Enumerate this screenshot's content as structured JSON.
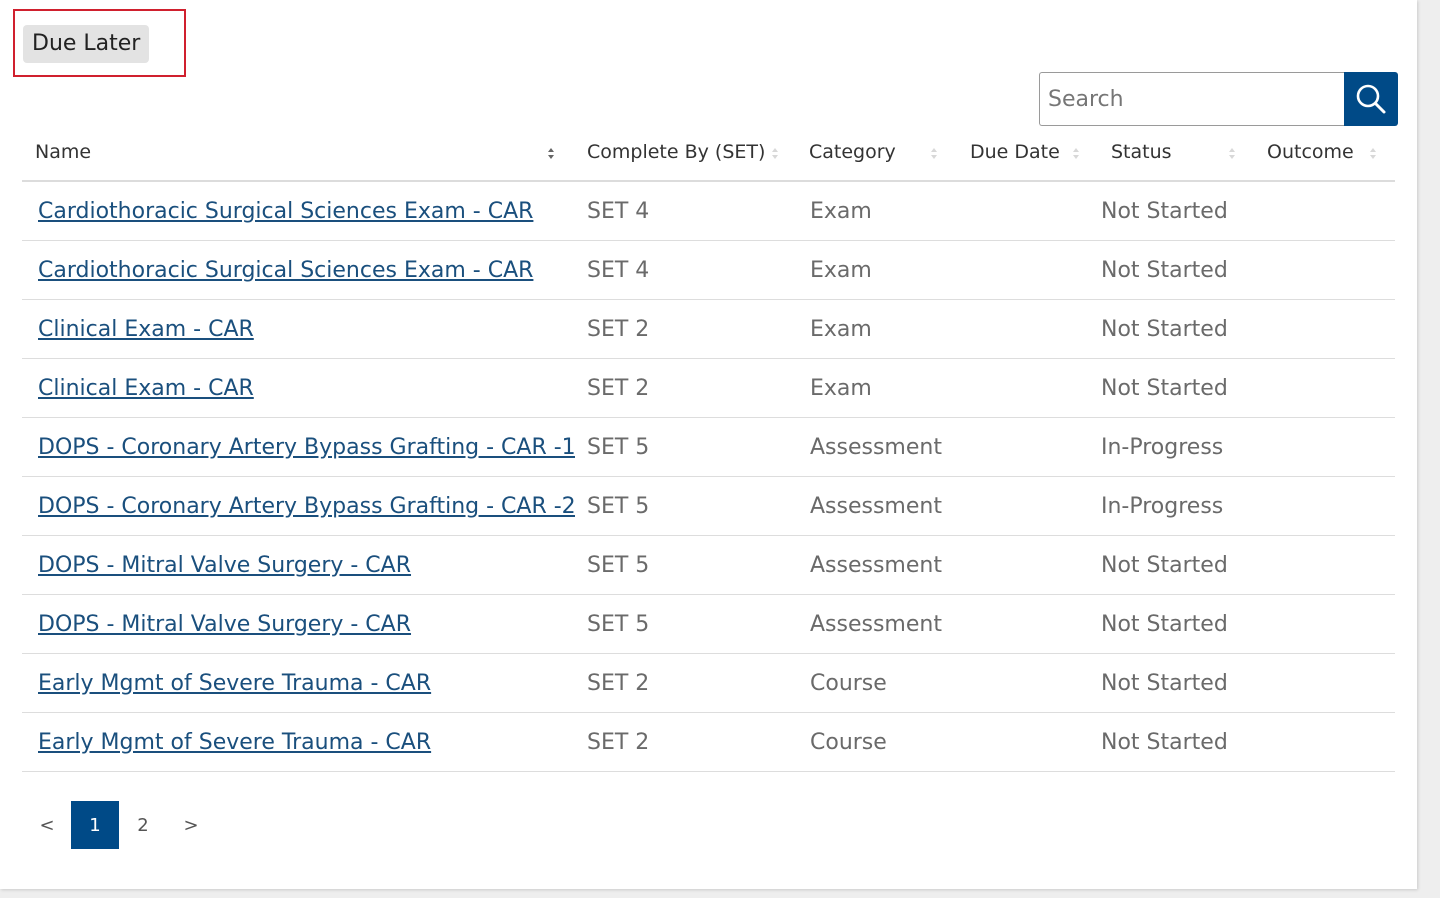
{
  "tab": {
    "label": "Due Later"
  },
  "search": {
    "placeholder": "Search"
  },
  "table": {
    "columns": [
      "Name",
      "Complete By (SET)",
      "Category",
      "Due Date",
      "Status",
      "Outcome"
    ],
    "rows": [
      {
        "name": "Cardiothoracic Surgical Sciences Exam - CAR",
        "set": "SET 4",
        "category": "Exam",
        "due_date": "",
        "status": "Not Started",
        "outcome": ""
      },
      {
        "name": "Cardiothoracic Surgical Sciences Exam - CAR",
        "set": "SET 4",
        "category": "Exam",
        "due_date": "",
        "status": "Not Started",
        "outcome": ""
      },
      {
        "name": "Clinical Exam - CAR",
        "set": "SET 2",
        "category": "Exam",
        "due_date": "",
        "status": "Not Started",
        "outcome": ""
      },
      {
        "name": "Clinical Exam - CAR",
        "set": "SET 2",
        "category": "Exam",
        "due_date": "",
        "status": "Not Started",
        "outcome": ""
      },
      {
        "name": "DOPS - Coronary Artery Bypass Grafting - CAR -1",
        "set": "SET 5",
        "category": "Assessment",
        "due_date": "",
        "status": "In-Progress",
        "outcome": ""
      },
      {
        "name": "DOPS - Coronary Artery Bypass Grafting - CAR -2",
        "set": "SET 5",
        "category": "Assessment",
        "due_date": "",
        "status": "In-Progress",
        "outcome": ""
      },
      {
        "name": "DOPS - Mitral Valve Surgery - CAR",
        "set": "SET 5",
        "category": "Assessment",
        "due_date": "",
        "status": "Not Started",
        "outcome": ""
      },
      {
        "name": "DOPS - Mitral Valve Surgery - CAR",
        "set": "SET 5",
        "category": "Assessment",
        "due_date": "",
        "status": "Not Started",
        "outcome": ""
      },
      {
        "name": "Early Mgmt of Severe Trauma - CAR",
        "set": "SET 2",
        "category": "Course",
        "due_date": "",
        "status": "Not Started",
        "outcome": ""
      },
      {
        "name": "Early Mgmt of Severe Trauma - CAR",
        "set": "SET 2",
        "category": "Course",
        "due_date": "",
        "status": "Not Started",
        "outcome": ""
      }
    ]
  },
  "pagination": {
    "prev": "<",
    "pages": [
      "1",
      "2"
    ],
    "current": "1",
    "next": ">"
  },
  "colors": {
    "accent": "#004a87",
    "link": "#1a4f7d",
    "highlight": "#d0202e"
  }
}
